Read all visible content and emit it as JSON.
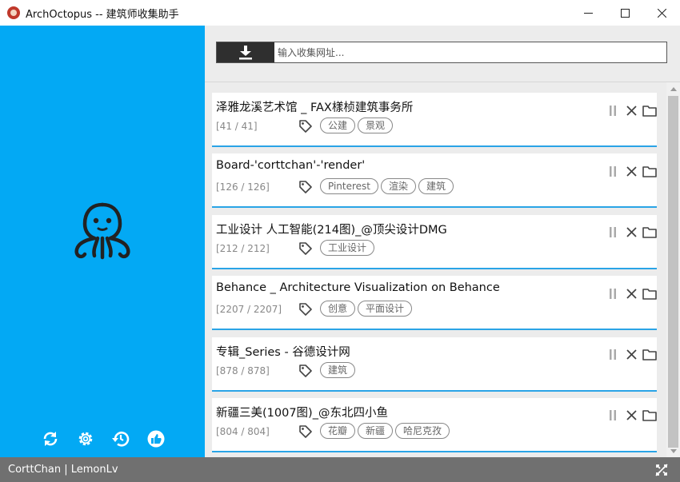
{
  "window": {
    "title": "ArchOctopus -- 建筑师收集助手"
  },
  "toolbar": {
    "url_placeholder": "输入收集网址...",
    "url_value": ""
  },
  "tasks": [
    {
      "title": "泽雅龙溪艺术馆 _ FAX樣桢建筑事务所",
      "count": "[41 / 41]",
      "tags": [
        "公建",
        "景观"
      ],
      "progress": 1.0
    },
    {
      "title": "Board-'corttchan'-'render'",
      "count": "[126 / 126]",
      "tags": [
        "Pinterest",
        "渲染",
        "建筑"
      ],
      "progress": 1.0
    },
    {
      "title": "工业设计 人工智能(214图)_@顶尖设计DMG",
      "count": "[212 / 212]",
      "tags": [
        "工业设计"
      ],
      "progress": 1.0
    },
    {
      "title": "Behance _ Architecture Visualization on Behance",
      "count": "[2207 / 2207]",
      "tags": [
        "创意",
        "平面设计"
      ],
      "progress": 1.0
    },
    {
      "title": "专辑_Series - 谷德设计网",
      "count": "[878 / 878]",
      "tags": [
        "建筑"
      ],
      "progress": 1.0
    },
    {
      "title": "新疆三美(1007图)_@东北四小鱼",
      "count": "[804 / 804]",
      "tags": [
        "花瓣",
        "新疆",
        "哈尼克孜"
      ],
      "progress": 1.0
    }
  ],
  "status": {
    "text": "CorttChan | LemonLv"
  },
  "icons": {
    "download": "download-icon",
    "pause": "pause-icon",
    "close": "close-icon",
    "folder": "folder-icon",
    "tag": "tag-icon",
    "sync": "sync-icon",
    "settings": "gear-icon",
    "history": "history-icon",
    "like": "thumbs-up-icon",
    "network": "network-off-icon"
  },
  "colors": {
    "sidebar": "#03a9f4",
    "progress": "#2aa4e6",
    "statusbar": "#707070",
    "download_button": "#2f2f2f"
  }
}
